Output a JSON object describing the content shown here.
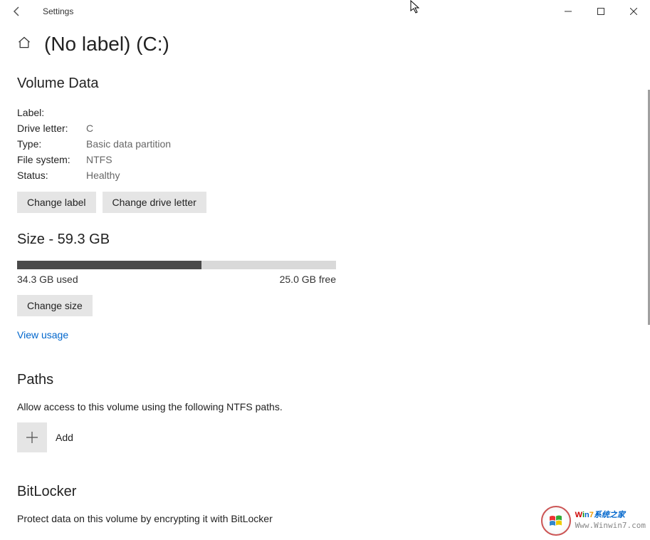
{
  "window": {
    "title": "Settings"
  },
  "page": {
    "title": "(No label) (C:)"
  },
  "volume_data": {
    "header": "Volume Data",
    "label_key": "Label:",
    "label_val": "",
    "drive_letter_key": "Drive letter:",
    "drive_letter_val": "C",
    "type_key": "Type:",
    "type_val": "Basic data partition",
    "filesystem_key": "File system:",
    "filesystem_val": "NTFS",
    "status_key": "Status:",
    "status_val": "Healthy",
    "change_label_btn": "Change label",
    "change_drive_letter_btn": "Change drive letter"
  },
  "size": {
    "header": "Size - 59.3 GB",
    "used": "34.3 GB used",
    "free": "25.0 GB free",
    "percent_used": 57.8,
    "change_size_btn": "Change size",
    "view_usage": "View usage"
  },
  "paths": {
    "header": "Paths",
    "description": "Allow access to this volume using the following NTFS paths.",
    "add_label": "Add"
  },
  "bitlocker": {
    "header": "BitLocker",
    "description": "Protect data on this volume by encrypting it with BitLocker"
  },
  "watermark": {
    "brand": "Win7系统之家",
    "url": "Www.Winwin7.com"
  }
}
